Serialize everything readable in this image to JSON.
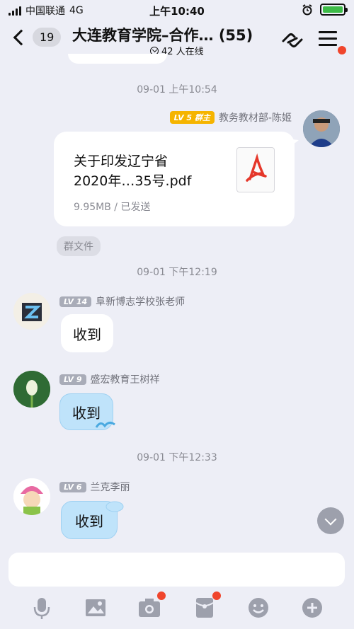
{
  "status_bar": {
    "carrier": "中国联通",
    "network": "4G",
    "time": "上午10:40"
  },
  "header": {
    "back_count": "19",
    "title": "大连教育学院–合作…",
    "member_count": "(55)",
    "online": "42 人在线"
  },
  "messages": [
    {
      "timestamp": "09-01 上午10:54"
    },
    {
      "sender": "教务教材部-陈姬",
      "level": "LV 5",
      "role": "群主",
      "file": {
        "name_line1": "关于印发辽宁省",
        "name_line2": "2020年…35号.pdf",
        "meta": "9.95MB / 已发送"
      },
      "tag": "群文件"
    },
    {
      "timestamp": "09-01 下午12:19"
    },
    {
      "sender": "阜新博志学校张老师",
      "level": "LV 14",
      "text": "收到"
    },
    {
      "sender": "盛宏教育王树祥",
      "level": "LV 9",
      "text": "收到"
    },
    {
      "timestamp": "09-01 下午12:33"
    },
    {
      "sender": "兰克李丽",
      "level": "LV 6",
      "text": "收到"
    }
  ],
  "colors": {
    "accent_red": "#f0452c",
    "bubble_blue": "#bfe3fa",
    "owner_gold": "#f5b400",
    "battery_green": "#3dbb47"
  },
  "toolbar_icons": [
    "microphone-icon",
    "image-icon",
    "camera-icon",
    "red-packet-icon",
    "emoji-icon",
    "plus-icon"
  ]
}
